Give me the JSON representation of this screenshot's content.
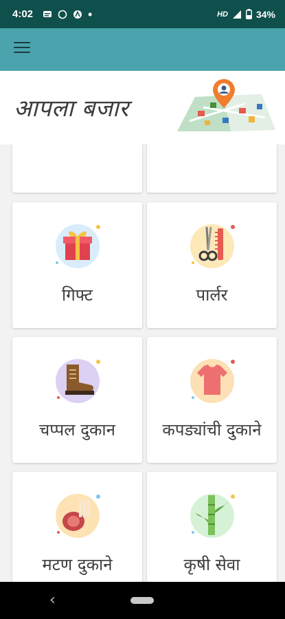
{
  "status_bar": {
    "time": "4:02",
    "hd": "HD",
    "battery": "34%"
  },
  "app_bar": {
    "menu_icon": "hamburger-menu-icon"
  },
  "header": {
    "title": "आपला बजार",
    "illustration": "map-pin-illustration"
  },
  "grid": {
    "items": [
      {
        "label": "गिफ्ट",
        "icon": "gift-icon",
        "bg": "#d9ecfb"
      },
      {
        "label": "पार्लर",
        "icon": "scissors-comb-icon",
        "bg": "#fde8b8"
      },
      {
        "label": "चप्पल  दुकान",
        "icon": "boot-icon",
        "bg": "#dcd0f3"
      },
      {
        "label": "कपड्यांची दुकाने",
        "icon": "tshirt-icon",
        "bg": "#fde0b5"
      },
      {
        "label": "मटण दुकाने",
        "icon": "meat-icon",
        "bg": "#fde2b4"
      },
      {
        "label": "कृषी सेवा",
        "icon": "sugarcane-icon",
        "bg": "#d6f2d6"
      }
    ]
  },
  "nav_bar": {
    "back_icon": "back-chevron-icon",
    "home_icon": "home-pill-icon"
  },
  "colors": {
    "status_bar": "#0f4f4c",
    "app_bar": "#4aa3ad"
  }
}
